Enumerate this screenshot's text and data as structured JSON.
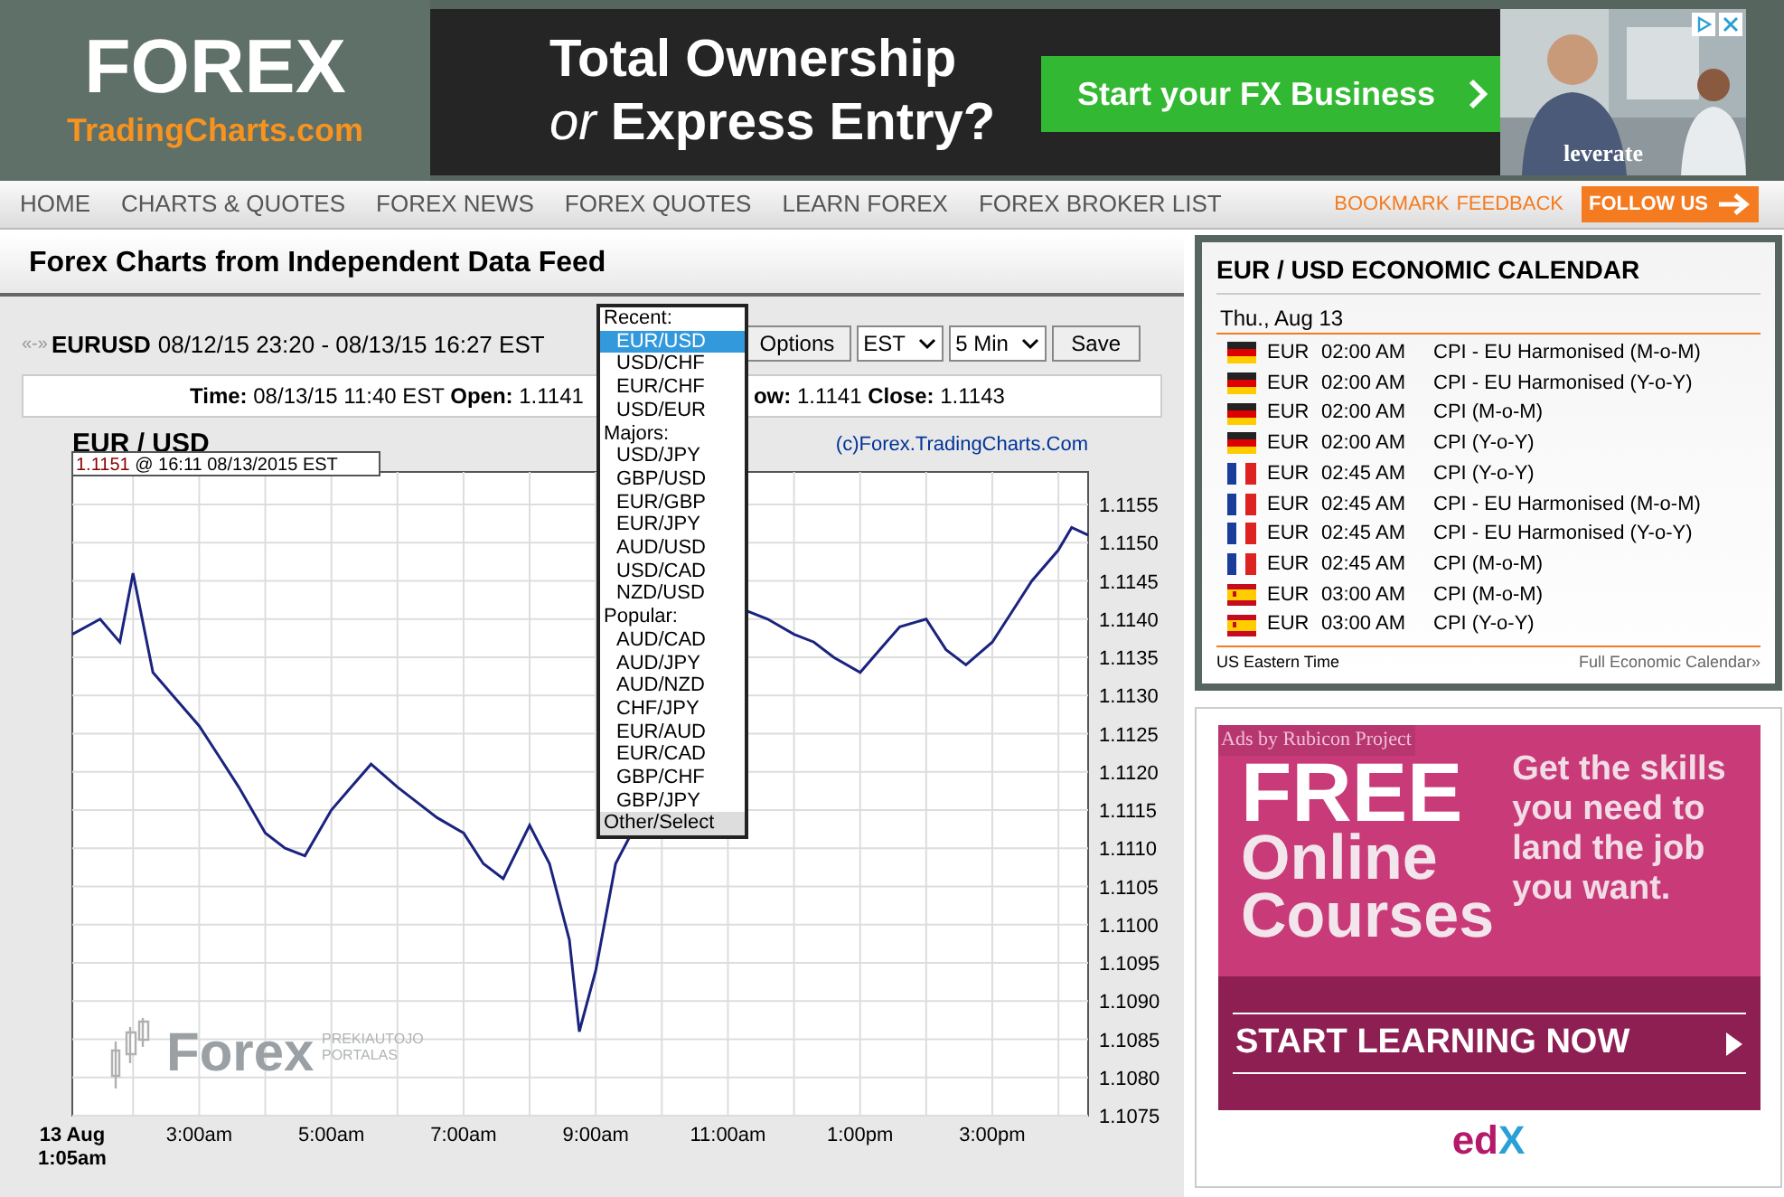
{
  "logo": {
    "title": "FOREX",
    "subtitle": "TradingCharts.com"
  },
  "banner": {
    "headline": "Total Ownership",
    "subline_word": "or",
    "subline_rest": "Express Entry?",
    "cta": "Start your FX Business",
    "brand": "leverate"
  },
  "nav": {
    "items": [
      "HOME",
      "CHARTS & QUOTES",
      "FOREX NEWS",
      "FOREX QUOTES",
      "LEARN FOREX",
      "FOREX BROKER LIST"
    ],
    "links": [
      "BOOKMARK",
      "FEEDBACK"
    ],
    "follow": "FOLLOW US"
  },
  "page_title": "Forex Charts from Independent Data Feed",
  "range": {
    "arrows": "«-»",
    "symbol": "EURUSD",
    "period": "08/12/15 23:20 - 08/13/15 16:27 EST"
  },
  "controls": {
    "options": "Options",
    "timezone": "EST",
    "interval": "5 Min",
    "save": "Save"
  },
  "ohlc": {
    "left": "**Time:** 08/13/15 11:40 EST **Open:** 1.1141",
    "right": "**ow:** 1.1141 **Close:** 1.1143"
  },
  "chart": {
    "pair": "EUR / USD",
    "copyright": "(c)Forex.TradingCharts.Com",
    "last_price": "1.1151",
    "last_time": "@ 16:11  08/13/2015 EST",
    "watermark_word": "Forex",
    "watermark_tag1": "PREKIAUTOJO",
    "watermark_tag2": "PORTALAS",
    "chart_data": {
      "type": "line",
      "x": [
        1.08,
        1.5,
        1.8,
        2.0,
        2.3,
        2.6,
        3.0,
        3.3,
        3.6,
        4.0,
        4.3,
        4.6,
        5.0,
        5.3,
        5.6,
        6.0,
        6.3,
        6.6,
        7.0,
        7.3,
        7.6,
        8.0,
        8.3,
        8.6,
        8.75,
        9.0,
        9.3,
        11.3,
        11.6,
        12.0,
        12.3,
        12.6,
        13.0,
        13.3,
        13.6,
        14.0,
        14.3,
        14.6,
        15.0,
        15.3,
        15.6,
        16.0,
        16.2,
        16.45
      ],
      "series": [
        {
          "color": "#1a237e",
          "values": [
            1.1138,
            1.114,
            1.1137,
            1.1146,
            1.1133,
            1.113,
            1.1126,
            1.1122,
            1.1118,
            1.1112,
            1.111,
            1.1109,
            1.1115,
            1.1118,
            1.1121,
            1.1118,
            1.1116,
            1.1114,
            1.1112,
            1.1108,
            1.1106,
            1.1113,
            1.1108,
            1.1098,
            1.1086,
            1.1094,
            1.1108,
            1.1141,
            1.114,
            1.1138,
            1.1137,
            1.1135,
            1.1133,
            1.1136,
            1.1139,
            1.114,
            1.1136,
            1.1134,
            1.1137,
            1.1141,
            1.1145,
            1.1149,
            1.1152,
            1.1151
          ]
        }
      ],
      "xlim": [
        1.08,
        16.45
      ],
      "ylim": [
        1.1075,
        1.1155
      ],
      "grid": true,
      "xticks": [
        {
          "value": 1.08,
          "label": "13 Aug 1:05am"
        },
        {
          "value": 3,
          "label": "3:00am"
        },
        {
          "value": 5,
          "label": "5:00am"
        },
        {
          "value": 7,
          "label": "7:00am"
        },
        {
          "value": 9,
          "label": "9:00am"
        },
        {
          "value": 11,
          "label": "11:00am"
        },
        {
          "value": 13,
          "label": "1:00pm"
        },
        {
          "value": 15,
          "label": "3:00pm"
        }
      ],
      "yticks": [
        {
          "value": 1.1075,
          "label": "1.1075"
        },
        {
          "value": 1.108,
          "label": "1.1080"
        },
        {
          "value": 1.1085,
          "label": "1.1085"
        },
        {
          "value": 1.109,
          "label": "1.1090"
        },
        {
          "value": 1.1095,
          "label": "1.1095"
        },
        {
          "value": 1.11,
          "label": "1.1100"
        },
        {
          "value": 1.1105,
          "label": "1.1105"
        },
        {
          "value": 1.111,
          "label": "1.1110"
        },
        {
          "value": 1.1115,
          "label": "1.1115"
        },
        {
          "value": 1.112,
          "label": "1.1120"
        },
        {
          "value": 1.1125,
          "label": "1.1125"
        },
        {
          "value": 1.113,
          "label": "1.1130"
        },
        {
          "value": 1.1135,
          "label": "1.1135"
        },
        {
          "value": 1.114,
          "label": "1.1140"
        },
        {
          "value": 1.1145,
          "label": "1.1145"
        },
        {
          "value": 1.115,
          "label": "1.1150"
        },
        {
          "value": 1.1155,
          "label": "1.1155"
        }
      ]
    }
  },
  "pair_menu": [
    {
      "kind": "group",
      "label": "Recent:"
    },
    {
      "kind": "option",
      "label": "EUR/USD",
      "selected": true
    },
    {
      "kind": "option",
      "label": "USD/CHF",
      "selected": false
    },
    {
      "kind": "option",
      "label": "EUR/CHF",
      "selected": false
    },
    {
      "kind": "option",
      "label": "USD/EUR",
      "selected": false
    },
    {
      "kind": "group",
      "label": "Majors:"
    },
    {
      "kind": "option",
      "label": "USD/JPY",
      "selected": false
    },
    {
      "kind": "option",
      "label": "GBP/USD",
      "selected": false
    },
    {
      "kind": "option",
      "label": "EUR/GBP",
      "selected": false
    },
    {
      "kind": "option",
      "label": "EUR/JPY",
      "selected": false
    },
    {
      "kind": "option",
      "label": "AUD/USD",
      "selected": false
    },
    {
      "kind": "option",
      "label": "USD/CAD",
      "selected": false
    },
    {
      "kind": "option",
      "label": "NZD/USD",
      "selected": false
    },
    {
      "kind": "group",
      "label": "Popular:"
    },
    {
      "kind": "option",
      "label": "AUD/CAD",
      "selected": false
    },
    {
      "kind": "option",
      "label": "AUD/JPY",
      "selected": false
    },
    {
      "kind": "option",
      "label": "AUD/NZD",
      "selected": false
    },
    {
      "kind": "option",
      "label": "CHF/JPY",
      "selected": false
    },
    {
      "kind": "option",
      "label": "EUR/AUD",
      "selected": false
    },
    {
      "kind": "option",
      "label": "EUR/CAD",
      "selected": false
    },
    {
      "kind": "option",
      "label": "GBP/CHF",
      "selected": false
    },
    {
      "kind": "option",
      "label": "GBP/JPY",
      "selected": false
    },
    {
      "kind": "footer",
      "label": "Other/Select"
    }
  ],
  "calendar": {
    "title": "EUR / USD ECONOMIC CALENDAR",
    "date": "Thu., Aug 13",
    "events": [
      {
        "kind": "de",
        "currency": "EUR",
        "time": "02:00 AM",
        "event": "CPI - EU Harmonised (M-o-M)"
      },
      {
        "kind": "de",
        "currency": "EUR",
        "time": "02:00 AM",
        "event": "CPI - EU Harmonised (Y-o-Y)"
      },
      {
        "kind": "de",
        "currency": "EUR",
        "time": "02:00 AM",
        "event": "CPI (M-o-M)"
      },
      {
        "kind": "de",
        "currency": "EUR",
        "time": "02:00 AM",
        "event": "CPI (Y-o-Y)"
      },
      {
        "kind": "fr",
        "currency": "EUR",
        "time": "02:45 AM",
        "event": "CPI (Y-o-Y)"
      },
      {
        "kind": "fr",
        "currency": "EUR",
        "time": "02:45 AM",
        "event": "CPI - EU Harmonised (M-o-M)"
      },
      {
        "kind": "fr",
        "currency": "EUR",
        "time": "02:45 AM",
        "event": "CPI - EU Harmonised (Y-o-Y)"
      },
      {
        "kind": "fr",
        "currency": "EUR",
        "time": "02:45 AM",
        "event": "CPI (M-o-M)"
      },
      {
        "kind": "es",
        "currency": "EUR",
        "time": "03:00 AM",
        "event": "CPI (M-o-M)"
      },
      {
        "kind": "es",
        "currency": "EUR",
        "time": "03:00 AM",
        "event": "CPI (Y-o-Y)"
      }
    ],
    "timezone": "US Eastern Time",
    "full_link": "Full Economic Calendar»"
  },
  "side_ad": {
    "network": "Ads by Rubicon Project",
    "word1": "FREE",
    "word2": "Online",
    "word3": "Courses",
    "pitch": "Get the skills you need to land the job you want.",
    "cta": "START LEARNING NOW",
    "brand_a": "ed",
    "brand_b": "X"
  }
}
